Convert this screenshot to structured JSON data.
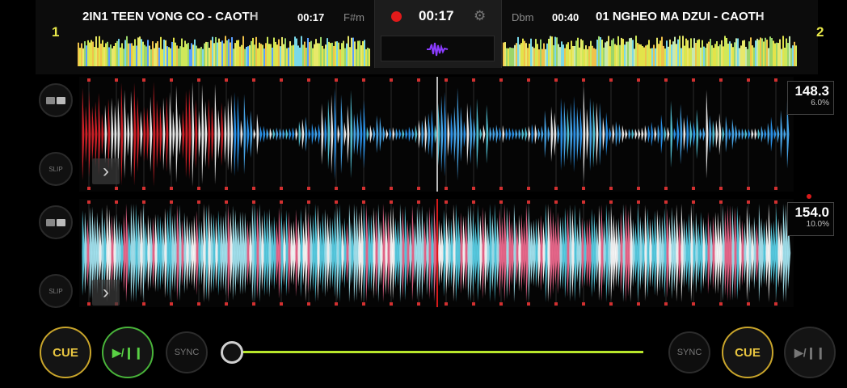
{
  "deck1": {
    "number": "1",
    "title": "2IN1 TEEN VONG CO - CAOTH",
    "elapsed": "00:17",
    "key": "F#m",
    "bpm": "148.3",
    "pitch": "6.0%",
    "loop_label": "",
    "slip_label": "SLIP",
    "cue_label": "CUE",
    "play_label": "▶/❙❙",
    "sync_label": "SYNC",
    "waveform_colors": [
      "#e3242b",
      "#4fb6ff",
      "#5ad1e8",
      "#ffffff",
      "#2fa0ff"
    ]
  },
  "deck2": {
    "number": "2",
    "title": "01 NGHEO MA DZUI - CAOTH",
    "elapsed": "00:40",
    "key": "Dbm",
    "bpm": "154.0",
    "pitch": "10.0%",
    "slip_label": "SLIP",
    "cue_label": "CUE",
    "play_label": "▶/❙❙",
    "sync_label": "SYNC",
    "waveform_colors": [
      "#f7a6c9",
      "#5ad1e8",
      "#a7e8f5",
      "#ffffff",
      "#f06a8f"
    ]
  },
  "master": {
    "time": "00:17",
    "record_icon": "record-icon",
    "settings_icon": "gear-icon"
  },
  "crossfader": {
    "position": 0.0
  },
  "colors": {
    "accent_yellow": "#e8e84a",
    "cue": "#e9c640",
    "play": "#59d144",
    "crossfader": "#b7e62a",
    "record": "#e01a1a"
  }
}
